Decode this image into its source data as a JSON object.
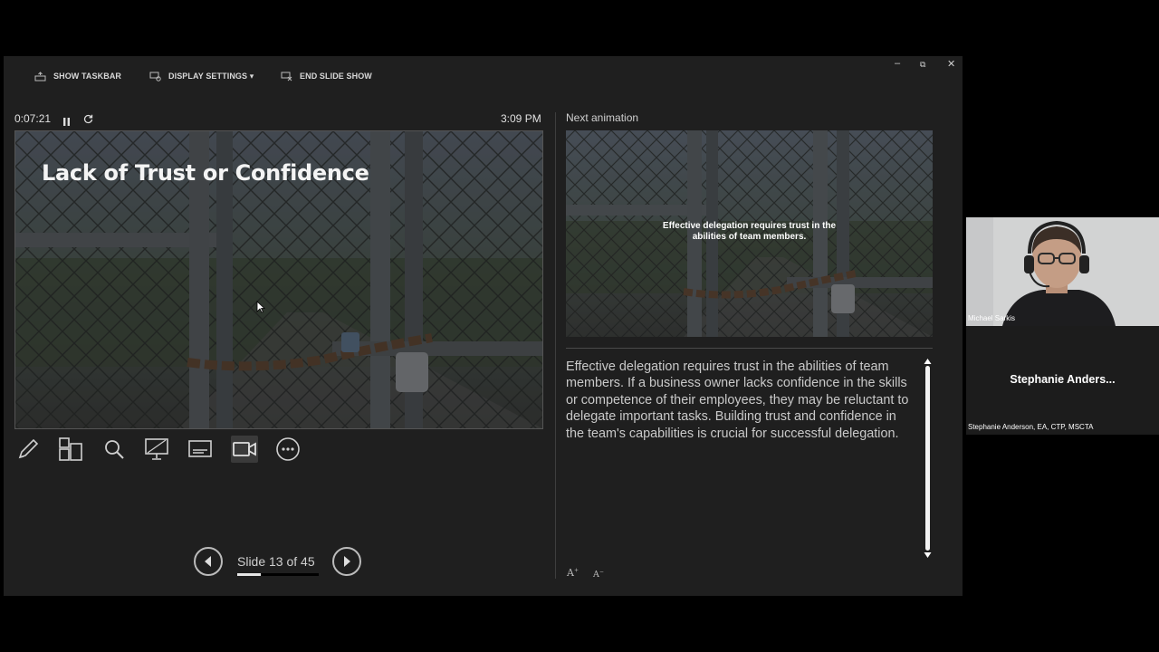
{
  "toolbar": {
    "show_taskbar": "SHOW TASKBAR",
    "display_settings": "DISPLAY SETTINGS ▾",
    "end_slide_show": "END SLIDE SHOW"
  },
  "window_controls": {
    "minimize": "–",
    "restore": "⧉",
    "close": "✕"
  },
  "presenter": {
    "timer": "0:07:21",
    "clock": "3:09 PM",
    "current_slide_title": "Lack of Trust or Confidence",
    "next_label": "Next animation",
    "next_caption": "Effective delegation requires trust in the abilities of team members.",
    "notes": "Effective delegation requires trust in the abilities of team members. If a business owner lacks confidence in the skills or competence of their employees, they may be reluctant to delegate important tasks. Building trust and confidence in the team's capabilities is crucial for successful delegation.",
    "slide_counter": "Slide 13 of 45",
    "slide_current": 13,
    "slide_total": 45,
    "tools": [
      "pen-icon",
      "slides-grid-icon",
      "zoom-icon",
      "screen-icon",
      "subtitles-icon",
      "camera-icon",
      "more-icon"
    ],
    "font_increase": "A",
    "font_decrease": "A"
  },
  "participants": [
    {
      "name": "Michael Sarkis"
    },
    {
      "display_name": "Stephanie  Anders...",
      "name": "Stephanie Anderson, EA, CTP, MSCTA"
    }
  ]
}
